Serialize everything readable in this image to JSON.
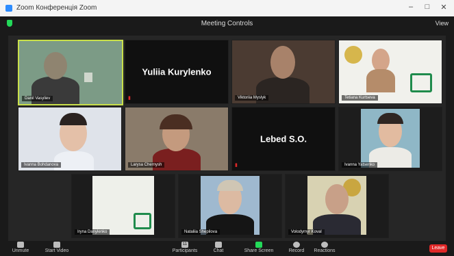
{
  "window": {
    "title": "Zoom Конференція Zoom"
  },
  "header": {
    "meeting_title": "Meeting Controls",
    "view_label": "View"
  },
  "tiles": [
    {
      "name": "Danil Vasyliev",
      "big_name": ""
    },
    {
      "name": "",
      "big_name": "Yuliia Kurylenko"
    },
    {
      "name": "Viktoriia Myslyk",
      "big_name": ""
    },
    {
      "name": "Tetiana Kurtseva",
      "big_name": ""
    },
    {
      "name": "Ivanna Bohdanova",
      "big_name": ""
    },
    {
      "name": "Larysa Chernysh",
      "big_name": ""
    },
    {
      "name": "",
      "big_name": "Lebed S.O."
    },
    {
      "name": "Ivanna Yatsenko",
      "big_name": ""
    },
    {
      "name": "Iryna Danylenko",
      "big_name": ""
    },
    {
      "name": "Nataliia Shepilova",
      "big_name": ""
    },
    {
      "name": "Volodymyr Koval",
      "big_name": ""
    }
  ],
  "toolbar": {
    "mute": "Unmute",
    "video": "Start Video",
    "participants_count": "11",
    "participants": "Participants",
    "chat": "Chat",
    "share": "Share Screen",
    "record": "Record",
    "reactions": "Reactions",
    "end": "Leave"
  },
  "colors": {
    "active_speaker": "#c9e04a",
    "end_button": "#e02828",
    "share_button": "#23d959"
  }
}
